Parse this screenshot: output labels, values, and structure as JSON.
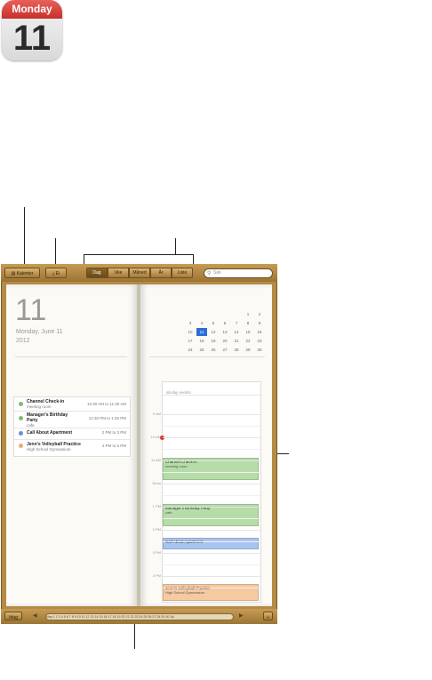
{
  "app_icon": {
    "weekday": "Monday",
    "day": "11"
  },
  "toolbar": {
    "calendars_label": "Kalenter",
    "inbox_label": "Ei",
    "view_tabs": [
      "Dag",
      "Uke",
      "Måned",
      "År",
      "Liste"
    ],
    "search_placeholder": "Søk"
  },
  "left_page": {
    "big_day": "11",
    "date_line": "Monday, June 11",
    "year_line": "2012",
    "events": [
      {
        "title": "Channel Check-in",
        "subtitle": "meeting room",
        "time": "10:30 AM to 11:30 AM",
        "color": "#7cbf6b"
      },
      {
        "title": "Manager's Birthday",
        "title2": "Party",
        "subtitle": "cafe",
        "time": "12:30 PM to 1:30 PM",
        "color": "#7cbf6b"
      },
      {
        "title": "Call About Apartment",
        "subtitle": "",
        "time": "2 PM to 3 PM",
        "color": "#6b8fd6"
      },
      {
        "title": "Jenn's Volleyball Practice",
        "subtitle": "High School Gymnasium",
        "time": "4 PM to 5 PM",
        "color": "#f2a96b"
      }
    ]
  },
  "mini_month": {
    "weekdays": [
      "S",
      "M",
      "T",
      "W",
      "T",
      "F",
      "S"
    ],
    "weeks": [
      [
        "",
        "",
        "",
        "",
        "",
        "1",
        "2"
      ],
      [
        "3",
        "4",
        "5",
        "6",
        "7",
        "8",
        "9"
      ],
      [
        "10",
        "11",
        "12",
        "13",
        "14",
        "15",
        "16"
      ],
      [
        "17",
        "18",
        "19",
        "20",
        "21",
        "22",
        "23"
      ],
      [
        "24",
        "25",
        "26",
        "27",
        "28",
        "29",
        "30"
      ]
    ],
    "today": "11"
  },
  "day_view": {
    "all_day_label": "all-day events",
    "hours": [
      "9 AM",
      "10 AM",
      "11 AM",
      "Noon",
      "1 PM",
      "2 PM",
      "3 PM",
      "4 PM"
    ],
    "blocks": [
      {
        "title": "Channel Check-in",
        "subtitle": "meeting room",
        "bg": "#b6dca8"
      },
      {
        "title": "Manager's Birthday Party",
        "subtitle": "cafe",
        "bg": "#b6dca8"
      },
      {
        "title": "Call About Apartment",
        "subtitle": "",
        "bg": "#a9c4f0"
      },
      {
        "title": "Jenn's Volleyball Practice",
        "subtitle": "High School Gymnasium",
        "bg": "#f7c9a0"
      }
    ]
  },
  "bottom_bar": {
    "today_label": "Idag",
    "add_label": "+",
    "strip_text": "May  1 2 3 4 5 6 7 8 9 10 11 12 13 14 15 16 17 18 19 20 21 22 23 24 25 26 27 28 29 30  Jul"
  }
}
